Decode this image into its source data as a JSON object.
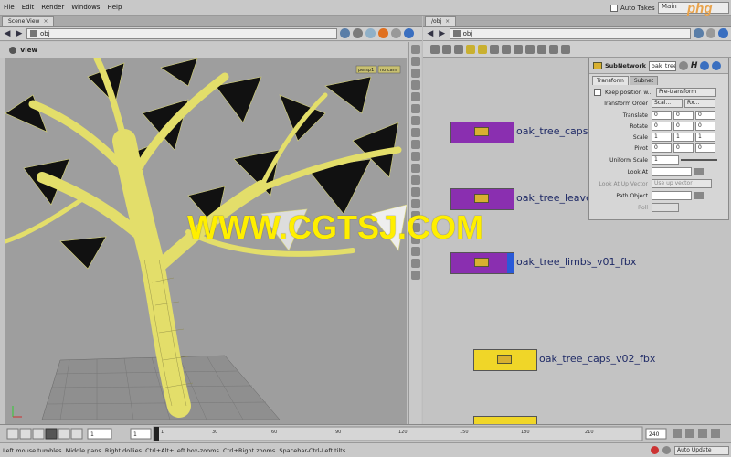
{
  "menubar": {
    "items": [
      "File",
      "Edit",
      "Render",
      "Windows",
      "Help"
    ],
    "auto_takes": "Auto Takes",
    "main_field": "Main"
  },
  "logo_text": "phg",
  "scene_view": {
    "tab_label": "Scene View",
    "path": "obj",
    "view_label": "View",
    "cam_labels": [
      "persp1",
      "no cam"
    ]
  },
  "network": {
    "tab_label": "/obj",
    "path": "obj"
  },
  "params": {
    "type_label": "SubNetwork",
    "node_name": "oak_tree",
    "tabs": [
      "Transform",
      "Subnet"
    ],
    "keep_position": "Keep position w...",
    "keep_value": "Pre-transform",
    "rows": [
      {
        "label": "Transform Order",
        "v1": "Scal...",
        "v2": "Rx..."
      },
      {
        "label": "Translate",
        "vals": [
          "0",
          "0",
          "0"
        ]
      },
      {
        "label": "Rotate",
        "vals": [
          "0",
          "0",
          "0"
        ]
      },
      {
        "label": "Scale",
        "vals": [
          "1",
          "1",
          "1"
        ]
      },
      {
        "label": "Pivot",
        "vals": [
          "0",
          "0",
          "0"
        ]
      },
      {
        "label": "Uniform Scale",
        "vals": [
          "1"
        ]
      },
      {
        "label": "Look At",
        "vals": []
      },
      {
        "label": "Look At Up Vector",
        "button": "Use up vector"
      },
      {
        "label": "Path Object",
        "vals": []
      },
      {
        "label": "Roll",
        "vals": []
      }
    ]
  },
  "nodes": [
    {
      "label": "oak_tree_caps",
      "color": "#8a2fb0"
    },
    {
      "label": "oak_tree_leave",
      "color": "#8a2fb0"
    },
    {
      "label": "oak_tree_limbs_v01_fbx",
      "color": "#8a2fb0"
    },
    {
      "label": "oak_tree_caps_v02_fbx",
      "color": "#f0d628"
    }
  ],
  "watermark": "WWW.CGTSJ.COM",
  "timeline": {
    "frame": "1",
    "start": "1",
    "ticks": [
      "1",
      "30",
      "60",
      "90",
      "120",
      "150",
      "180",
      "210"
    ],
    "end": "240"
  },
  "status": {
    "message": "Left mouse tumbles. Middle pans. Right dollies. Ctrl+Alt+Left box-zooms. Ctrl+Right zooms. Spacebar-Ctrl-Left tilts.",
    "auto_update": "Auto Update"
  }
}
